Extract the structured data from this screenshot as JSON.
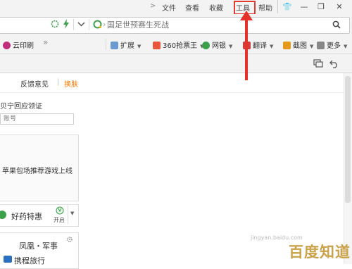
{
  "menubar": {
    "chevron": ">",
    "items": [
      "文件",
      "查看",
      "收藏",
      "工具",
      "帮助"
    ],
    "window_buttons": [
      "👕",
      "—",
      "❐",
      "✕"
    ]
  },
  "addressbar": {
    "search_placeholder": "国足世预赛生死战",
    "search_icon": "search-icon"
  },
  "bookmarks": {
    "left_item": "云印刷",
    "overflow": "»",
    "items": [
      {
        "label": "扩展",
        "icon": "extensions-icon",
        "color": "#6b9bd1"
      },
      {
        "label": "360抢票王",
        "icon": "ticket-icon",
        "color": "#e8573b"
      },
      {
        "label": "网银",
        "icon": "bank-icon",
        "color": "#3aa14a"
      },
      {
        "label": "翻译",
        "icon": "translate-icon",
        "color": "#d23b3b"
      },
      {
        "label": "截图",
        "icon": "screenshot-icon",
        "color": "#e59a1a"
      },
      {
        "label": "更多",
        "icon": "more-icon",
        "color": "#888888"
      }
    ]
  },
  "content": {
    "feedback_link": "反馈意见",
    "separator": "|",
    "skin_link": "换肤",
    "skin_color": "#ff7a00",
    "lead_text": "贝宁回应领证",
    "login_placeholder": "账号",
    "ad_text": "苹果包场推荐游戏上线",
    "pharmacy_label": "好药特惠",
    "pharmacy_toggle": "开启",
    "news_title": "凤凰・军事",
    "travel_label": "携程旅行"
  },
  "watermark": {
    "logo": "百度知道",
    "url": "jingyan.baidu.com"
  },
  "colors": {
    "annotation_red": "#e53228",
    "toolbar_bg": "#f3f3f3"
  }
}
